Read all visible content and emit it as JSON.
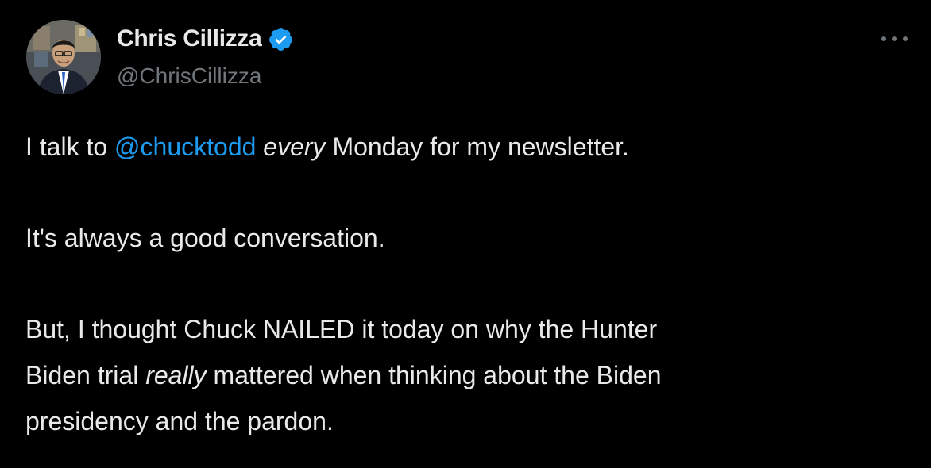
{
  "author": {
    "display_name": "Chris Cillizza",
    "handle": "@ChrisCillizza",
    "verified": true,
    "verified_color": "#1d9bf0"
  },
  "more_icon": "ellipsis-icon",
  "tweet": {
    "line1": {
      "pre": "I talk to ",
      "mention": "@chucktodd",
      "emphasis": "every",
      "post": " Monday for my newsletter."
    },
    "line2": "It's always a good conversation.",
    "line3": "But, I thought Chuck NAILED it today on why the Hunter",
    "line4": {
      "pre": "Biden trial ",
      "emphasis": "really",
      "post": " mattered when thinking about the Biden"
    },
    "line5": "presidency and the pardon."
  },
  "colors": {
    "background": "#000000",
    "text": "#e7e9ea",
    "secondary": "#71767b",
    "link": "#1d9bf0"
  }
}
